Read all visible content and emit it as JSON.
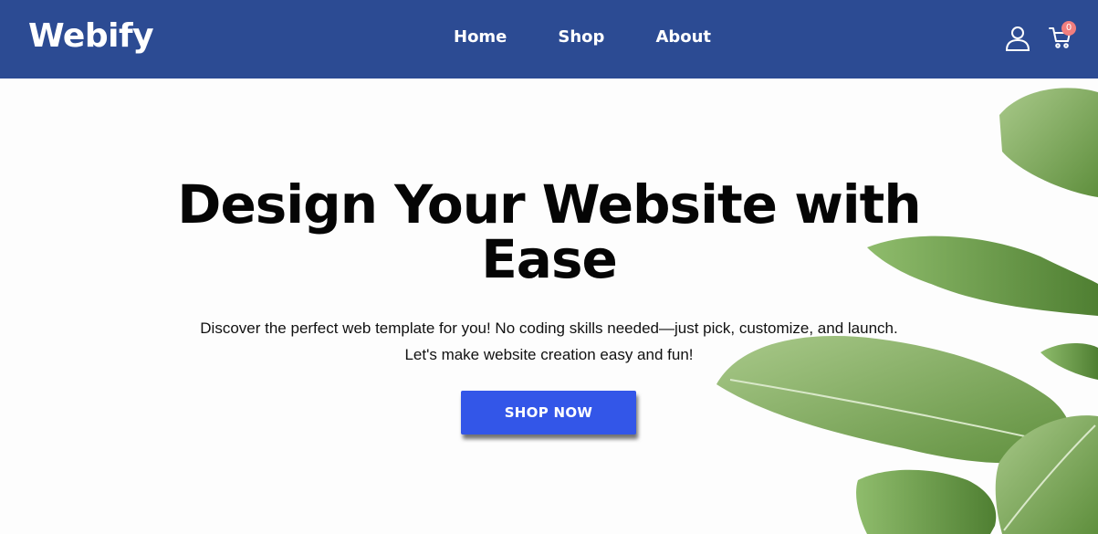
{
  "brand": {
    "name": "Webify",
    "color": "#2c4b93"
  },
  "nav": {
    "links": [
      {
        "label": "Home"
      },
      {
        "label": "Shop"
      },
      {
        "label": "About"
      }
    ],
    "user_icon": "user-icon",
    "cart_icon": "shopping-cart-icon",
    "cart_count": "0",
    "badge_color": "#f07e7e"
  },
  "hero": {
    "title": "Design Your Website with Ease",
    "line1": "Discover the perfect web template for you! No coding skills needed—just pick, customize, and launch.",
    "line2": "Let's make website creation easy and fun!",
    "cta_label": "SHOP NOW",
    "cta_color": "#3356e8"
  }
}
